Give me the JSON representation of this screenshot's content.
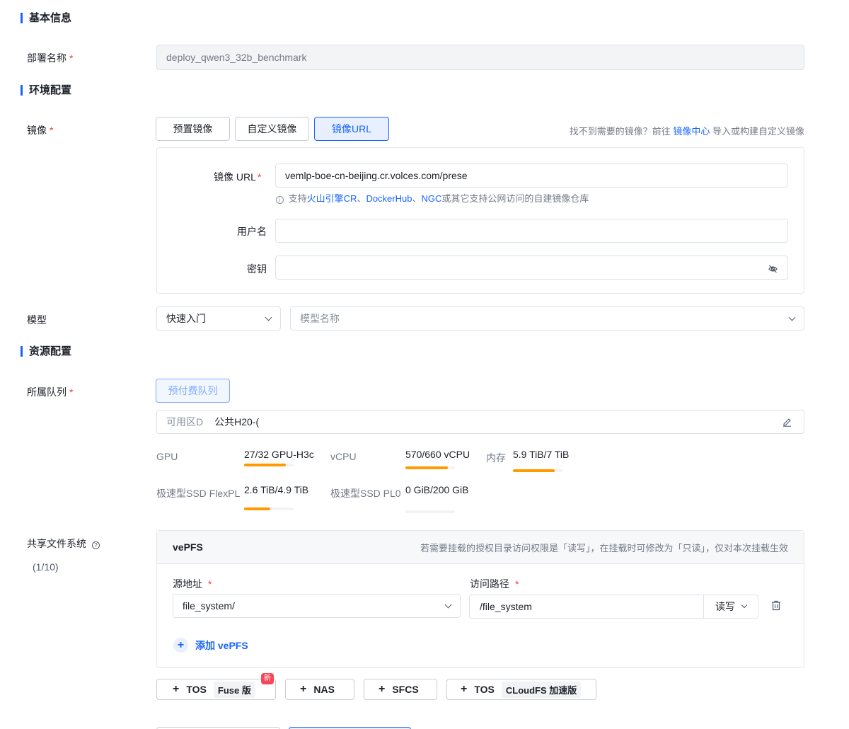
{
  "sections": {
    "basic": "基本信息",
    "env": "环境配置",
    "resource": "资源配置"
  },
  "deploy_name": {
    "label": "部署名称",
    "required": "*",
    "value": "deploy_qwen3_32b_benchmark"
  },
  "image": {
    "label": "镜像",
    "required": "*",
    "tabs": [
      "预置镜像",
      "自定义镜像",
      "镜像URL"
    ],
    "active_tab": "镜像URL",
    "help_prefix": "找不到需要的镜像？前往",
    "help_link": "镜像中心",
    "help_suffix": "导入或构建自定义镜像",
    "url_label": "镜像 URL",
    "url_value": "vemlp-boe-cn-beijing.cr.volces.com/prese",
    "url_hint_prefix": "支持",
    "url_hint_link1": "火山引擎CR",
    "url_hint_sep1": "、",
    "url_hint_link2": "DockerHub",
    "url_hint_sep2": "、",
    "url_hint_link3": "NGC",
    "url_hint_suffix": "或其它支持公网访问的自建镜像仓库",
    "username_label": "用户名",
    "username_value": "",
    "password_label": "密钥",
    "password_value": "",
    "password_icon": "eye-off-icon"
  },
  "model": {
    "label": "模型",
    "source_value": "快速入门",
    "name_placeholder": "模型名称"
  },
  "queue": {
    "label": "所属队列",
    "required": "*",
    "tag": "预付费队列",
    "zone_label": "可用区D",
    "zone_value": "公共H20-(",
    "stats": [
      {
        "label": "GPU",
        "value": "27/32 GPU-H3c",
        "fraction": 0.84
      },
      {
        "label": "vCPU",
        "value": "570/660 vCPU",
        "fraction": 0.86
      },
      {
        "label": "内存",
        "value": "5.9 TiB/7 TiB",
        "fraction": 0.84
      },
      {
        "label": "极速型SSD FlexPL",
        "value": "2.6 TiB/4.9 TiB",
        "fraction": 0.53
      },
      {
        "label": "极速型SSD PL0",
        "value": "0 GiB/200 GiB",
        "fraction": 0.0
      }
    ]
  },
  "fs": {
    "label": "共享文件系统",
    "count": "(1/10)",
    "panel_title": "vePFS",
    "panel_note": "若需要挂载的授权目录访问权限是「读写」，在挂载时可修改为「只读」，仅对本次挂载生效",
    "source_label": "源地址",
    "source_required": "*",
    "source_value": "file_system/",
    "path_label": "访问路径",
    "path_required": "*",
    "path_value": "/file_system",
    "perm_value": "读写",
    "add_label": "添加 vePFS",
    "mount_buttons": [
      {
        "label": "TOS",
        "tag": "Fuse 版",
        "badge": "新"
      },
      {
        "label": "NAS"
      },
      {
        "label": "SFCS"
      },
      {
        "label": "TOS",
        "tag": "CLoudFS 加速版"
      }
    ]
  },
  "colors": {
    "primary": "#1664ff",
    "required": "#f53f3f",
    "usage_bar": "#ff9a00"
  }
}
